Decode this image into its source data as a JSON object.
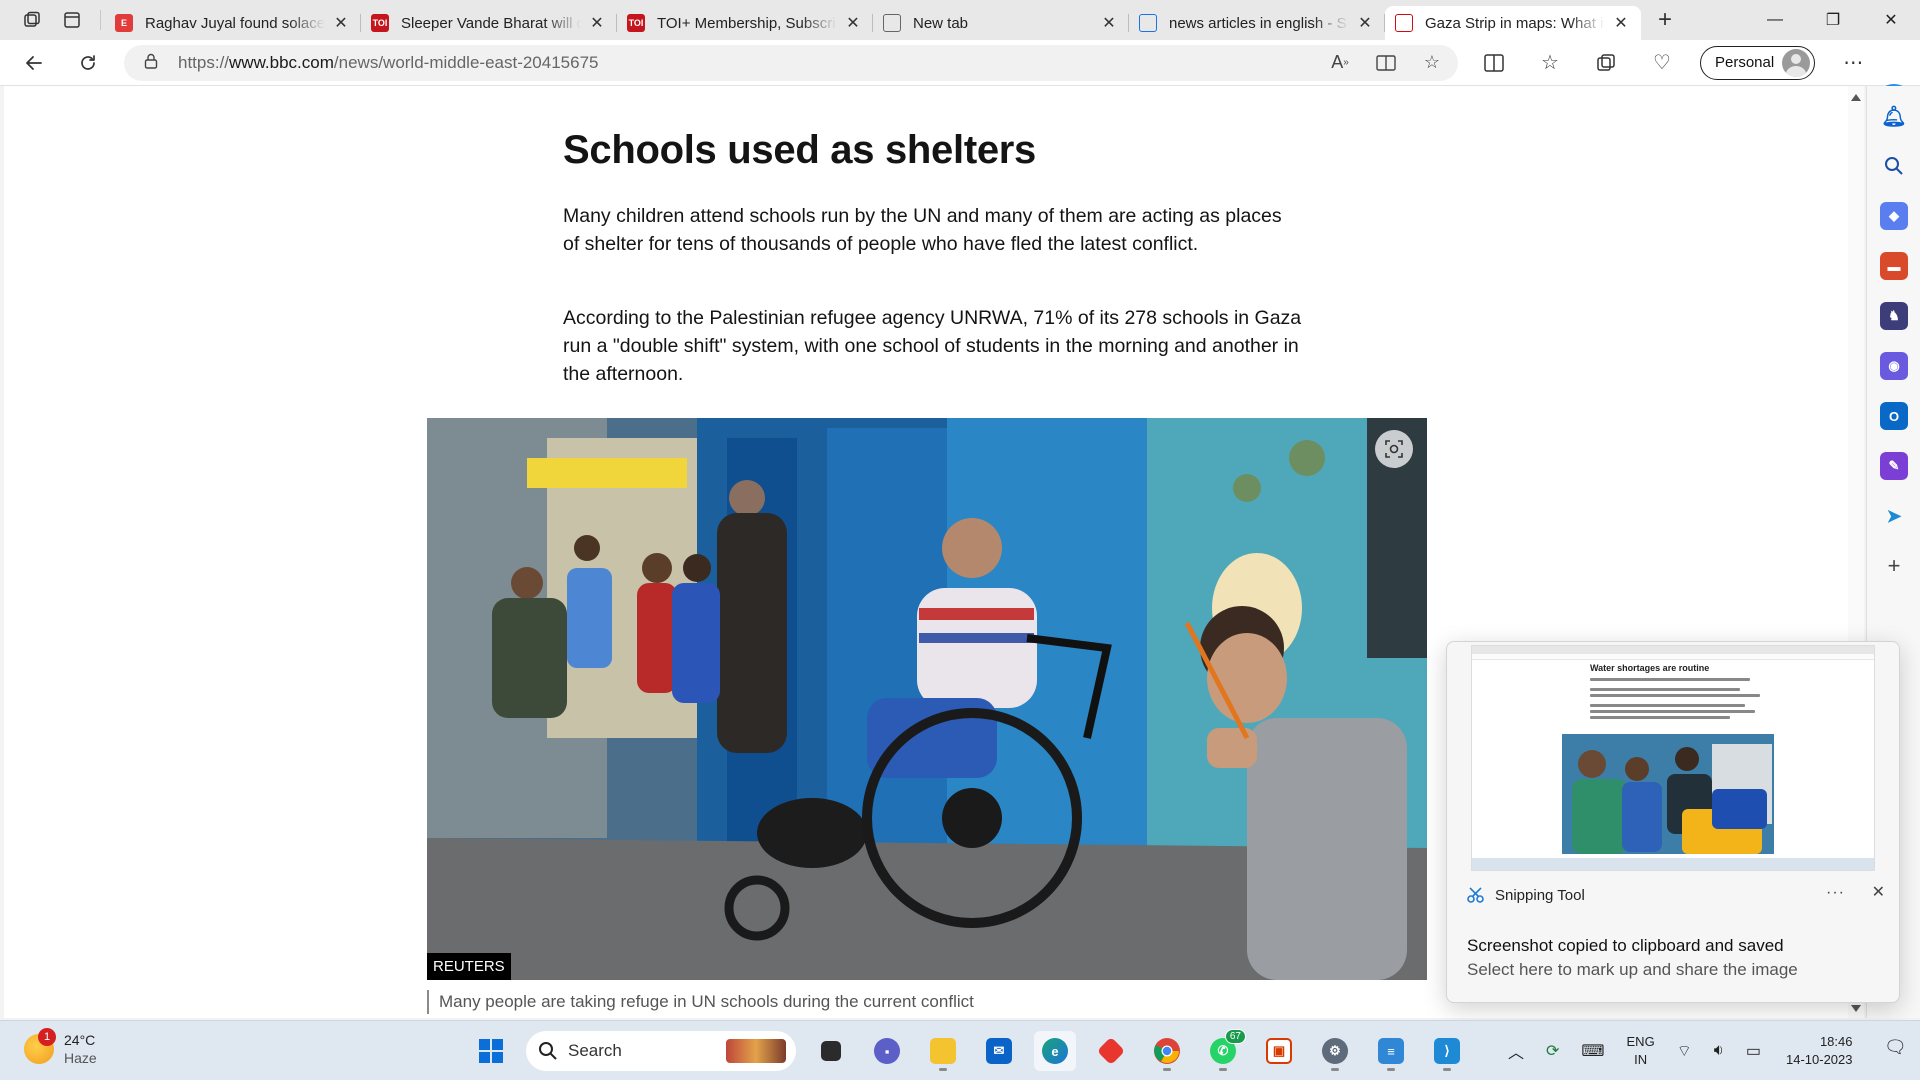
{
  "browser": {
    "tabs": [
      {
        "title": "Raghav Juyal found solace",
        "favicon_letter": "E",
        "favicon_color": "#e23b3b",
        "active": false
      },
      {
        "title": "Sleeper Vande Bharat will c",
        "favicon_letter": "TOI",
        "favicon_color": "#c4161c",
        "active": false
      },
      {
        "title": "TOI+ Membership, Subscri",
        "favicon_letter": "TOI",
        "favicon_color": "#c4161c",
        "active": false
      },
      {
        "title": "New tab",
        "favicon_letter": "",
        "favicon_color": "#666666",
        "active": false
      },
      {
        "title": "news articles in english - S",
        "favicon_letter": "",
        "favicon_color": "#1a73e8",
        "active": false
      },
      {
        "title": "Gaza Strip in maps: What it",
        "favicon_letter": "",
        "favicon_color": "#d10a11",
        "active": true
      }
    ],
    "address": {
      "prefix": "https://",
      "host": "www.bbc.com",
      "path": "/news/world-middle-east-20415675"
    },
    "profile_label": "Personal"
  },
  "article": {
    "headline": "Schools used as shelters",
    "paragraph_1": "Many children attend schools run by the UN and many of them are acting as places of shelter for tens of thousands of people who have fled the latest conflict.",
    "paragraph_2": "According to the Palestinian refugee agency UNRWA, 71% of its 278 schools in Gaza run a \"double shift\" system, with one school of students in the morning and another in the afternoon.",
    "image_credit": "REUTERS",
    "image_caption": "Many people are taking refuge in UN schools during the current conflict"
  },
  "toast": {
    "app_name": "Snipping Tool",
    "message": "Screenshot copied to clipboard and saved",
    "sub_message": "Select here to mark up and share the image",
    "thumbnail_title": "Water shortages are routine"
  },
  "taskbar": {
    "weather": {
      "temp": "24°C",
      "condition": "Haze",
      "badge": "1"
    },
    "search_label": "Search",
    "whatsapp_badge": "67",
    "lang": {
      "line1": "ENG",
      "line2": "IN"
    },
    "clock": {
      "time": "18:46",
      "date": "14-10-2023"
    }
  }
}
